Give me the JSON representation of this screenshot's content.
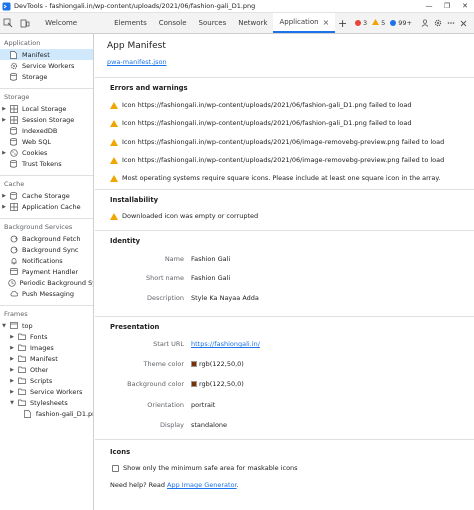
{
  "window": {
    "title": "DevTools - fashiongali.in/wp-content/uploads/2021/06/fashion-gali_D1.png",
    "controls": [
      "—",
      "❐",
      "✕"
    ]
  },
  "tabs": [
    {
      "label": "Welcome",
      "active": false
    },
    {
      "label": "Elements",
      "active": false
    },
    {
      "label": "Console",
      "active": false
    },
    {
      "label": "Sources",
      "active": false
    },
    {
      "label": "Network",
      "active": false
    },
    {
      "label": "Application",
      "active": true
    }
  ],
  "tab_close": "×",
  "tab_add": "+",
  "status": {
    "errors": "3",
    "warnings": "5",
    "info": "99+",
    "error_color": "#e8453c",
    "warning_color": "#f0a500",
    "info_color": "#1a73e8"
  },
  "toolbar_icons": [
    "settings-icon",
    "more-icon",
    "close-icon"
  ],
  "sidebar": {
    "application": {
      "heading": "Application",
      "items": [
        {
          "label": "Manifest",
          "selected": true
        },
        {
          "label": "Service Workers"
        },
        {
          "label": "Storage"
        }
      ]
    },
    "storage": {
      "heading": "Storage",
      "items": [
        {
          "label": "Local Storage",
          "expandable": true
        },
        {
          "label": "Session Storage",
          "expandable": true
        },
        {
          "label": "IndexedDB"
        },
        {
          "label": "Web SQL"
        },
        {
          "label": "Cookies",
          "expandable": true
        },
        {
          "label": "Trust Tokens"
        }
      ]
    },
    "cache": {
      "heading": "Cache",
      "items": [
        {
          "label": "Cache Storage"
        },
        {
          "label": "Application Cache"
        }
      ]
    },
    "background": {
      "heading": "Background Services",
      "items": [
        {
          "label": "Background Fetch"
        },
        {
          "label": "Background Sync"
        },
        {
          "label": "Notifications"
        },
        {
          "label": "Payment Handler"
        },
        {
          "label": "Periodic Background Sync"
        },
        {
          "label": "Push Messaging"
        }
      ]
    },
    "frames": {
      "heading": "Frames",
      "top": "top",
      "items": [
        {
          "label": "Fonts"
        },
        {
          "label": "Images"
        },
        {
          "label": "Manifest"
        },
        {
          "label": "Other"
        },
        {
          "label": "Scripts"
        },
        {
          "label": "Service Workers"
        },
        {
          "label": "Stylesheets"
        }
      ],
      "file": "fashion-gali_D1.png"
    }
  },
  "main": {
    "title": "App Manifest",
    "manifest_link": "pwa-manifest.json",
    "errors": {
      "heading": "Errors and warnings",
      "items": [
        "Icon https://fashiongali.in/wp-content/uploads/2021/06/fashion-gali_D1.png failed to load",
        "Icon https://fashiongali.in/wp-content/uploads/2021/06/fashion-gali_D1.png failed to load",
        "Icon https://fashiongali.in/wp-content/uploads/2021/06/image-removebg-preview.png failed to load",
        "Icon https://fashiongali.in/wp-content/uploads/2021/06/image-removebg-preview.png failed to load",
        "Most operating systems require square icons. Please include at least one square icon in the array."
      ]
    },
    "installability": {
      "heading": "Installability",
      "items": [
        "Downloaded icon was empty or corrupted"
      ]
    },
    "identity": {
      "heading": "Identity",
      "name_label": "Name",
      "name": "Fashion Gali",
      "short_name_label": "Short name",
      "short_name": "Fashion Gali",
      "description_label": "Description",
      "description": "Style Ka Nayaa Adda"
    },
    "presentation": {
      "heading": "Presentation",
      "start_url_label": "Start URL",
      "start_url": "https://fashiongali.in/",
      "theme_color_label": "Theme color",
      "theme_color": "rgb(122,50,0)",
      "theme_swatch": "#7a3200",
      "bg_color_label": "Background color",
      "bg_color": "rgb(122,50,0)",
      "bg_swatch": "#7a3200",
      "orientation_label": "Orientation",
      "orientation": "portrait",
      "display_label": "Display",
      "display": "standalone"
    },
    "icons": {
      "heading": "Icons",
      "checkbox_label": "Show only the minimum safe area for maskable icons",
      "help_prefix": "Need help? Read ",
      "help_link": "App Image Generator",
      "help_suffix": "."
    }
  }
}
